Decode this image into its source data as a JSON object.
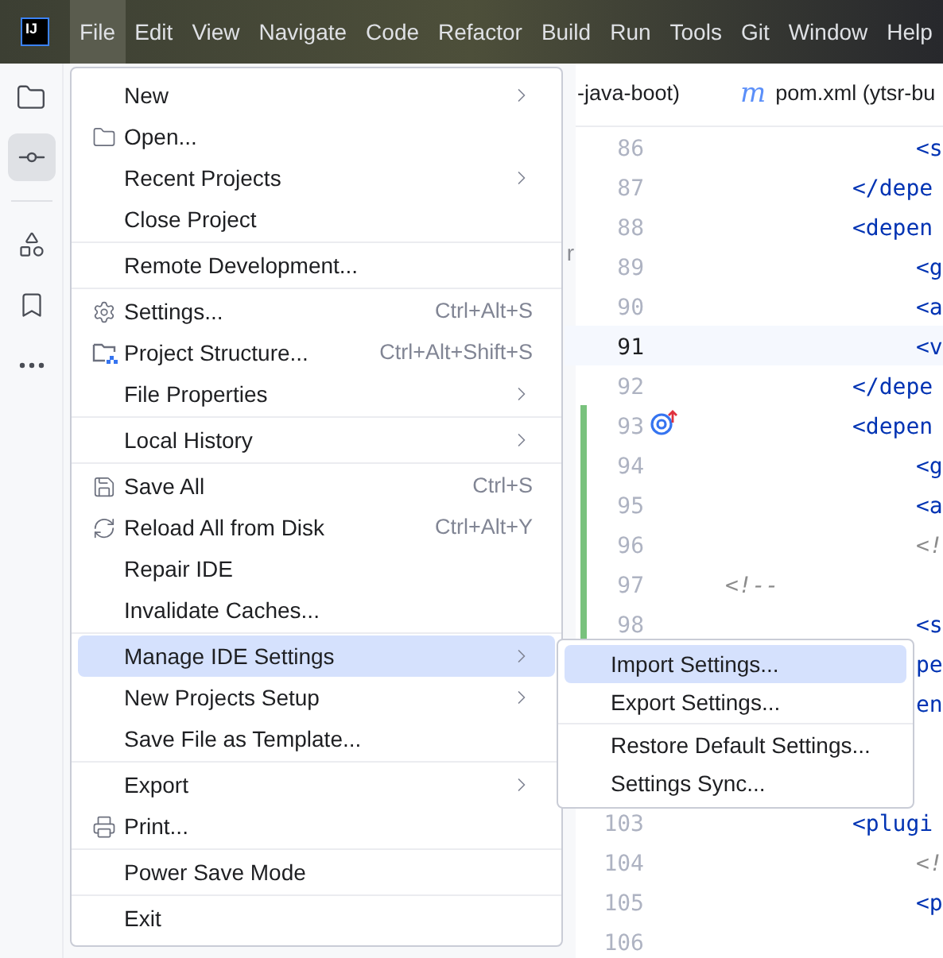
{
  "menu_bar": {
    "logo": "IJ",
    "items": [
      {
        "label": "File",
        "selected": true
      },
      {
        "label": "Edit",
        "selected": false
      },
      {
        "label": "View",
        "selected": false
      },
      {
        "label": "Navigate",
        "selected": false
      },
      {
        "label": "Code",
        "selected": false
      },
      {
        "label": "Refactor",
        "selected": false
      },
      {
        "label": "Build",
        "selected": false
      },
      {
        "label": "Run",
        "selected": false
      },
      {
        "label": "Tools",
        "selected": false
      },
      {
        "label": "Git",
        "selected": false
      },
      {
        "label": "Window",
        "selected": false
      },
      {
        "label": "Help",
        "selected": false
      }
    ]
  },
  "tool_strip": [
    {
      "kind": "folder",
      "selected": false
    },
    {
      "kind": "commit",
      "selected": true
    },
    {
      "kind": "separator"
    },
    {
      "kind": "structure",
      "selected": false
    },
    {
      "kind": "bookmark",
      "selected": false
    },
    {
      "kind": "more",
      "selected": false
    }
  ],
  "project_panel": {
    "fragment": "r"
  },
  "editor_tabs": [
    {
      "label": "-java-boot)",
      "kind": "plain"
    },
    {
      "label": "pom.xml (ytsr-bu",
      "kind": "maven",
      "icon_text": "m"
    }
  ],
  "code_lines": [
    {
      "number": "86",
      "kind": "level3",
      "code": "<s"
    },
    {
      "number": "87",
      "kind": "level2",
      "code": "</depe"
    },
    {
      "number": "88",
      "kind": "level2",
      "code": "<depen"
    },
    {
      "number": "89",
      "kind": "level3",
      "code": "<g"
    },
    {
      "number": "90",
      "kind": "level3",
      "code": "<a"
    },
    {
      "number": "91",
      "kind": "level3",
      "code": "<v",
      "current": true
    },
    {
      "number": "92",
      "kind": "level2",
      "code": "</depe"
    },
    {
      "number": "93",
      "kind": "level2",
      "code": "<depen",
      "gutter_mark": true,
      "changed": true
    },
    {
      "number": "94",
      "kind": "level3",
      "code": "<g",
      "changed": true
    },
    {
      "number": "95",
      "kind": "level3",
      "code": "<a",
      "changed": true
    },
    {
      "number": "96",
      "kind": "level3",
      "code": "<!",
      "comment": true,
      "changed": true
    },
    {
      "number": "97",
      "kind": "level0",
      "code": "<!--",
      "comment": true,
      "changed": true
    },
    {
      "number": "98",
      "kind": "level3",
      "code": "<s",
      "changed": true
    },
    {
      "kind": "level3",
      "code": "pe"
    },
    {
      "kind": "level3",
      "code": "en"
    },
    {
      "kind": "level3"
    },
    {
      "kind": "level3"
    },
    {
      "number": "103",
      "kind": "level2",
      "code": "<plugi"
    },
    {
      "number": "104",
      "kind": "level3",
      "code": "<!",
      "comment": true
    },
    {
      "number": "105",
      "kind": "level3",
      "code": "<p"
    },
    {
      "number": "106",
      "kind": "level3"
    }
  ],
  "file_menu": [
    [
      {
        "label": "New",
        "submenu": true,
        "selected": false
      },
      {
        "label": "Open...",
        "kind": "folder",
        "selected": false
      },
      {
        "label": "Recent Projects",
        "submenu": true,
        "selected": false
      },
      {
        "label": "Close Project",
        "selected": false
      }
    ],
    [
      {
        "label": "Remote Development...",
        "selected": false
      }
    ],
    [
      {
        "label": "Settings...",
        "kind": "gear",
        "shortcut": "Ctrl+Alt+S",
        "selected": false
      },
      {
        "label": "Project Structure...",
        "kind": "structure",
        "shortcut": "Ctrl+Alt+Shift+S",
        "selected": false
      },
      {
        "label": "File Properties",
        "submenu": true,
        "selected": false
      }
    ],
    [
      {
        "label": "Local History",
        "submenu": true,
        "selected": false
      }
    ],
    [
      {
        "label": "Save All",
        "kind": "save",
        "shortcut": "Ctrl+S",
        "selected": false
      },
      {
        "label": "Reload All from Disk",
        "kind": "reload",
        "shortcut": "Ctrl+Alt+Y",
        "selected": false
      },
      {
        "label": "Repair IDE",
        "selected": false
      },
      {
        "label": "Invalidate Caches...",
        "selected": false
      }
    ],
    [
      {
        "label": "Manage IDE Settings",
        "submenu": true,
        "selected": true
      },
      {
        "label": "New Projects Setup",
        "submenu": true,
        "selected": false
      },
      {
        "label": "Save File as Template...",
        "selected": false
      }
    ],
    [
      {
        "label": "Export",
        "submenu": true,
        "selected": false
      },
      {
        "label": "Print...",
        "kind": "print",
        "selected": false
      }
    ],
    [
      {
        "label": "Power Save Mode",
        "selected": false
      }
    ],
    [
      {
        "label": "Exit",
        "selected": false
      }
    ]
  ],
  "settings_submenu": [
    [
      {
        "label": "Import Settings...",
        "selected": true
      },
      {
        "label": "Export Settings...",
        "selected": false
      }
    ],
    [
      {
        "label": "Restore Default Settings...",
        "selected": false
      },
      {
        "label": "Settings Sync...",
        "selected": false
      }
    ]
  ]
}
